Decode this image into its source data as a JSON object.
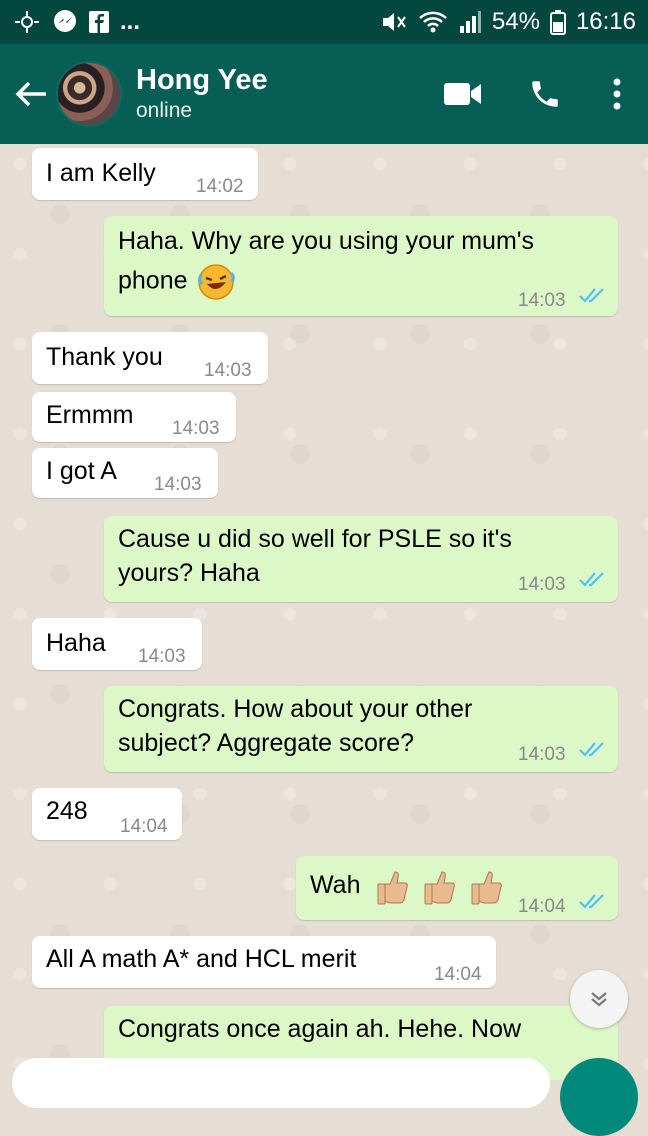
{
  "status_bar": {
    "battery": "54%",
    "time": "16:16",
    "more": "..."
  },
  "header": {
    "contact_name": "Hong Yee",
    "status": "online"
  },
  "messages": [
    {
      "dir": "in",
      "text": "I am Kelly",
      "time": "14:02"
    },
    {
      "dir": "out",
      "text": "Haha. Why are you using your mum's",
      "text2": "phone",
      "time": "14:03"
    },
    {
      "dir": "in",
      "text": "Thank you",
      "time": "14:03"
    },
    {
      "dir": "in",
      "text": "Ermmm",
      "time": "14:03"
    },
    {
      "dir": "in",
      "text": "I got A",
      "time": "14:03"
    },
    {
      "dir": "out",
      "text": "Cause u did so well for PSLE so it's",
      "text2": "yours? Haha",
      "time": "14:03"
    },
    {
      "dir": "in",
      "text": "Haha",
      "time": "14:03"
    },
    {
      "dir": "out",
      "text": "Congrats. How about your other",
      "text2": "subject? Aggregate score?",
      "time": "14:03"
    },
    {
      "dir": "in",
      "text": "248",
      "time": "14:04"
    },
    {
      "dir": "out",
      "text": "Wah",
      "time": "14:04"
    },
    {
      "dir": "in",
      "text": "All A math A* and HCL merit",
      "time": "14:04"
    },
    {
      "dir": "out",
      "text": "Congrats once again ah. Hehe. Now"
    }
  ],
  "icons": [
    "back-arrow-icon",
    "video-call-icon",
    "phone-icon",
    "menu-icon",
    "read-ticks-icon",
    "laughing-emoji-icon",
    "thumbs-up-icon",
    "chevron-down-icon"
  ],
  "colors": {
    "header": "#075e54",
    "status_bar": "#04473f",
    "outgoing": "#dcf8c6",
    "incoming": "#ffffff",
    "read_ticks": "#4fc3f7"
  }
}
